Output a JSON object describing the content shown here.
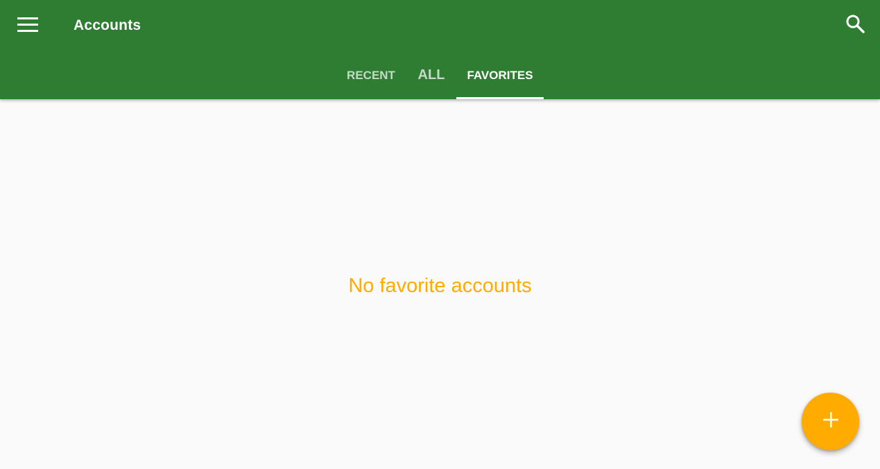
{
  "app_bar": {
    "title": "Accounts",
    "menu_icon": "hamburger-menu-icon",
    "search_icon": "search-icon",
    "background_color": "#2e7d32"
  },
  "tabs": [
    {
      "label": "RECENT",
      "selected": false
    },
    {
      "label": "ALL",
      "selected": false
    },
    {
      "label": "FAVORITES",
      "selected": true
    }
  ],
  "main": {
    "empty_message": "No favorite accounts",
    "empty_message_color": "#ffab00"
  },
  "fab": {
    "icon": "plus-icon",
    "color": "#ffab00"
  }
}
